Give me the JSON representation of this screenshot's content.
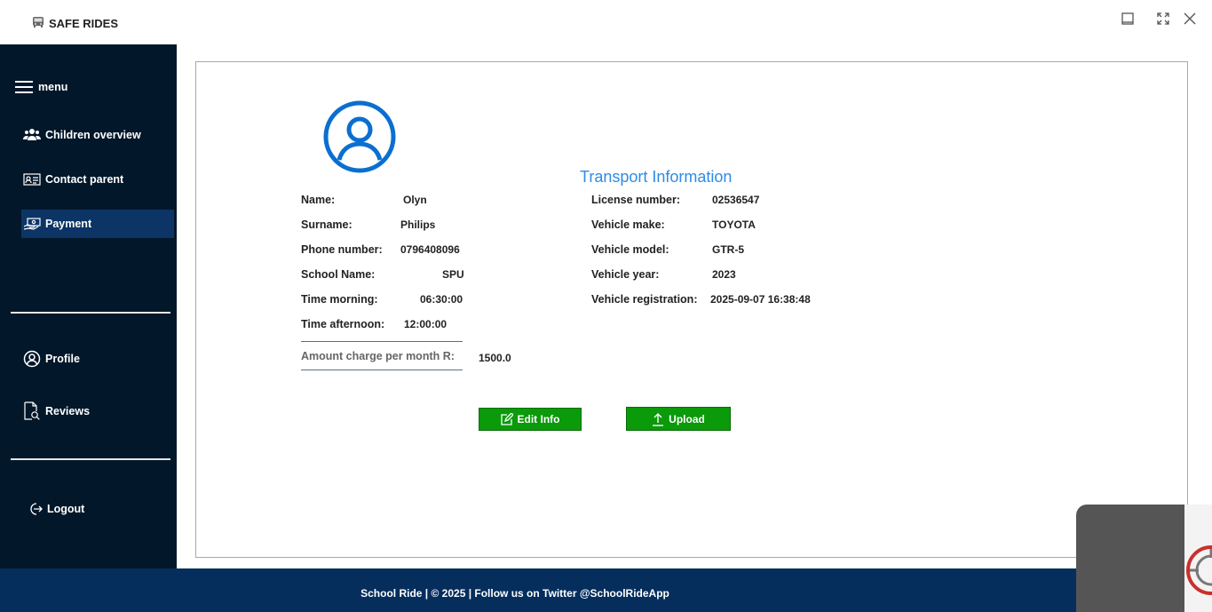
{
  "app": {
    "title": "SAFE RIDES",
    "logo_icon": "bus-icon"
  },
  "window_controls": {
    "minimize_icon": "minimize-icon",
    "maximize_icon": "maximize-icon",
    "close_icon": "close-icon"
  },
  "sidebar": {
    "menu_label": "menu",
    "items": [
      {
        "label": "Children overview",
        "icon": "users-icon"
      },
      {
        "label": "Contact parent",
        "icon": "contact-card-icon"
      },
      {
        "label": "Payment",
        "icon": "payment-icon",
        "active": true
      }
    ],
    "bottom_items": [
      {
        "label": "Profile",
        "icon": "user-circle-icon"
      },
      {
        "label": "Reviews",
        "icon": "reviews-icon"
      }
    ],
    "logout_label": "Logout"
  },
  "profile": {
    "avatar_icon": "user-circle-icon",
    "fields": [
      {
        "label": "Name:",
        "value": "Olyn"
      },
      {
        "label": "Surname:",
        "value": "Philips"
      },
      {
        "label": "Phone number:",
        "value": "0796408096"
      },
      {
        "label": "School Name:",
        "value": "SPU"
      },
      {
        "label": "Time morning:",
        "value": "06:30:00"
      },
      {
        "label": "Time afternoon:",
        "value": "12:00:00"
      }
    ],
    "amount_label": "Amount charge per month R:",
    "amount_value": "1500.0"
  },
  "transport": {
    "title": "Transport Information",
    "fields": [
      {
        "label": "License number:",
        "value": "02536547"
      },
      {
        "label": "Vehicle make:",
        "value": "TOYOTA"
      },
      {
        "label": "Vehicle model:",
        "value": "GTR-5"
      },
      {
        "label": "Vehicle year:",
        "value": "2023"
      },
      {
        "label": "Vehicle registration:",
        "value": "2025-09-07 16:38:48"
      }
    ]
  },
  "actions": {
    "edit_label": "Edit Info",
    "upload_label": "Upload"
  },
  "footer": {
    "text": "School Ride | © 2025 | Follow us on Twitter @SchoolRideApp"
  },
  "colors": {
    "sidebar_bg": "#03172a",
    "active_item_bg": "#0c3566",
    "footer_bg": "#052e5d",
    "accent_blue": "#0a6fd0",
    "button_green": "#0a9a0a"
  }
}
